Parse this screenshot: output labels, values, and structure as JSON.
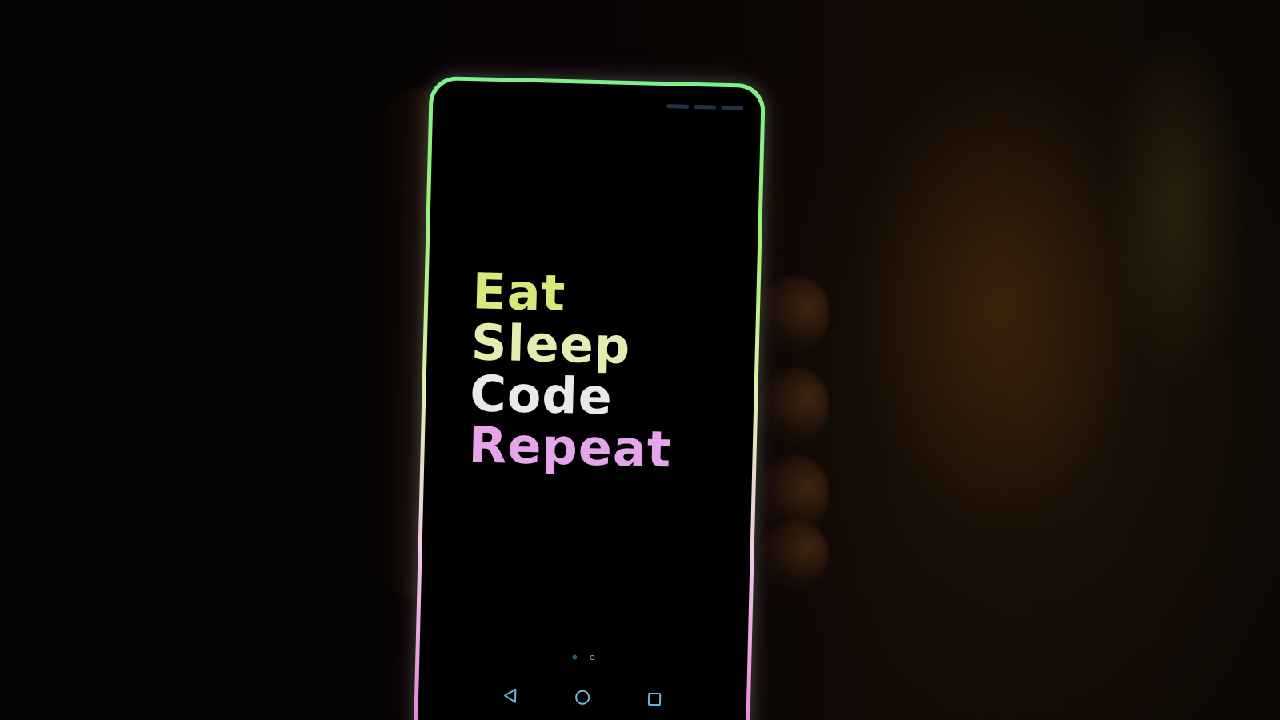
{
  "screen": {
    "lines": [
      "Eat",
      "Sleep",
      "Code",
      "Repeat"
    ]
  },
  "pager": {
    "page_count": 2,
    "current_page": 2
  },
  "navbar": {
    "icons": [
      "back-icon",
      "home-icon",
      "recents-icon"
    ],
    "icon_color": "#6fb6e0"
  },
  "colors": {
    "bezel_top": "#7ef08a",
    "bezel_bottom": "#e87ae0",
    "eat": "#d8e87a",
    "sleep": "#e4ecb0",
    "code": "#ece8e8",
    "repeat": "#e6a4ea"
  }
}
